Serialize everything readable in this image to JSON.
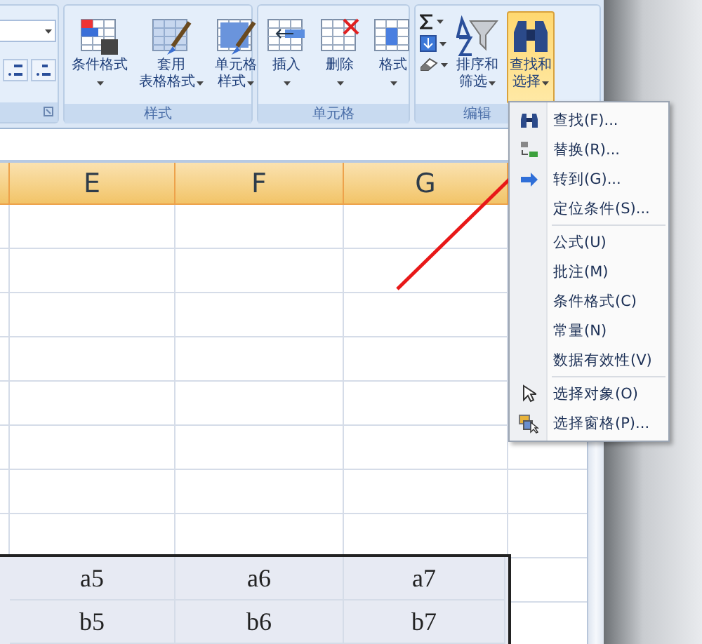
{
  "ribbon": {
    "groups": [
      {
        "kind": "number",
        "launcher": true,
        "buttons": [
          {
            "kind": "increase-decimal"
          },
          {
            "kind": "decrease-decimal"
          }
        ]
      },
      {
        "kind": "large",
        "label": "样式",
        "buttons": [
          {
            "lines": [
              "条件格式"
            ],
            "selected": false
          },
          {
            "lines": [
              "套用",
              "表格格式"
            ],
            "selected": false
          },
          {
            "lines": [
              "单元格",
              "样式"
            ],
            "selected": false
          }
        ]
      },
      {
        "kind": "large",
        "label": "单元格",
        "buttons": [
          {
            "lines": [
              "插入"
            ],
            "selected": false
          },
          {
            "lines": [
              "删除"
            ],
            "selected": false
          },
          {
            "lines": [
              "格式"
            ],
            "selected": false
          }
        ]
      },
      {
        "kind": "edit",
        "label": "编辑",
        "buttons": [
          {
            "lines": [
              "排序和",
              "筛选"
            ],
            "selected": false
          },
          {
            "lines": [
              "查找和",
              "选择"
            ],
            "selected": true
          }
        ]
      }
    ]
  },
  "columns": [
    "E",
    "F",
    "G"
  ],
  "rows": [
    [
      "a5",
      "a6",
      "a7"
    ],
    [
      "b5",
      "b6",
      "b7"
    ]
  ],
  "menu": {
    "sections": [
      [
        {
          "label": "查找(F)..."
        },
        {
          "label": "替换(R)..."
        },
        {
          "label": "转到(G)..."
        },
        {
          "label": "定位条件(S)..."
        }
      ],
      [
        {
          "label": "公式(U)"
        },
        {
          "label": "批注(M)"
        },
        {
          "label": "条件格式(C)"
        },
        {
          "label": "常量(N)"
        },
        {
          "label": "数据有效性(V)"
        }
      ],
      [
        {
          "label": "选择对象(O)"
        },
        {
          "label": "选择窗格(P)..."
        }
      ]
    ]
  }
}
